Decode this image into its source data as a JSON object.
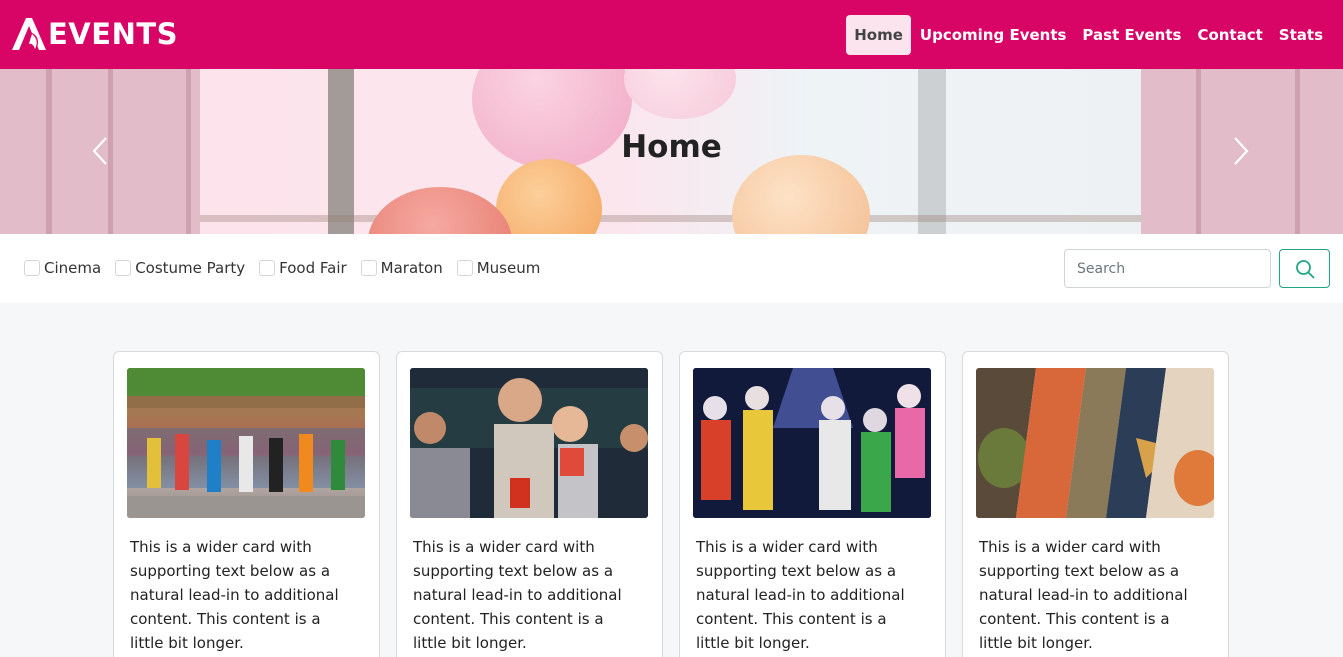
{
  "brand": {
    "name": "EVENTS",
    "logo_letter": "A"
  },
  "nav": {
    "items": [
      {
        "label": "Home",
        "active": true
      },
      {
        "label": "Upcoming Events",
        "active": false
      },
      {
        "label": "Past Events",
        "active": false
      },
      {
        "label": "Contact",
        "active": false
      },
      {
        "label": "Stats",
        "active": false
      }
    ]
  },
  "hero": {
    "title": "Home",
    "prev_icon": "chevron-left-icon",
    "next_icon": "chevron-right-icon"
  },
  "filters": {
    "categories": [
      {
        "label": "Cinema",
        "checked": false
      },
      {
        "label": "Costume Party",
        "checked": false
      },
      {
        "label": "Food Fair",
        "checked": false
      },
      {
        "label": "Maraton",
        "checked": false
      },
      {
        "label": "Museum",
        "checked": false
      }
    ],
    "search": {
      "placeholder": "Search",
      "value": "",
      "button_icon": "search-icon"
    }
  },
  "cards": [
    {
      "image": "marathon-runners",
      "text": "This is a wider card with supporting text below as a natural lead-in to additional content. This content is a little bit longer."
    },
    {
      "image": "cinema-audience",
      "text": "This is a wider card with supporting text below as a natural lead-in to additional content. This content is a little bit longer."
    },
    {
      "image": "costume-party-clowns",
      "text": "This is a wider card with supporting text below as a natural lead-in to additional content. This content is a little bit longer."
    },
    {
      "image": "food-fair-dishes",
      "text": "This is a wider card with supporting text below as a natural lead-in to additional content. This content is a little bit longer."
    }
  ],
  "colors": {
    "primary": "#d80466",
    "active_bg": "#fbe4ee",
    "accent": "#20a489",
    "page_bg": "#f6f7f9"
  }
}
